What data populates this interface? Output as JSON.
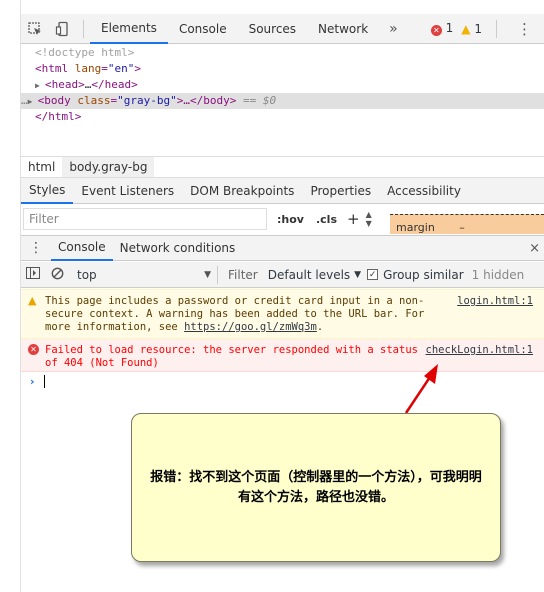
{
  "toolbar": {
    "tabs": [
      "Elements",
      "Console",
      "Sources",
      "Network"
    ],
    "active_tab": "Elements",
    "more": "»",
    "error_count": "1",
    "warning_count": "1",
    "icons": [
      "inspect-icon",
      "device-toolbar-icon",
      "kebab-menu-icon"
    ]
  },
  "dom": {
    "line1": "<!doctype html>",
    "line2_tag": "<html",
    "line2_attr": "lang",
    "line2_val": "\"en\"",
    "line2_end": ">",
    "line3_open": "<head>",
    "line3_mid": "…",
    "line3_close": "</head>",
    "line4_prefix": "…",
    "line4_open": "<body",
    "line4_attr": "class",
    "line4_val": "\"gray-bg\"",
    "line4_mid": ">…",
    "line4_close": "</body>",
    "line4_suffix": "== $0",
    "line5": "</html>"
  },
  "breadcrumbs": [
    "html",
    "body.gray-bg"
  ],
  "subtabs": [
    "Styles",
    "Event Listeners",
    "DOM Breakpoints",
    "Properties",
    "Accessibility"
  ],
  "styles": {
    "filter_placeholder": "Filter",
    "hov": ":hov",
    "cls": ".cls",
    "plus": "+",
    "box_label": "margin",
    "box_value": "–"
  },
  "drawer": {
    "tabs": [
      "Console",
      "Network conditions"
    ],
    "close": "×"
  },
  "console_bar": {
    "context": "top",
    "filter": "Filter",
    "levels": "Default levels",
    "group_similar": "Group similar",
    "hidden": "1 hidden"
  },
  "messages": {
    "warning_text_1": "This page includes a password or credit card input in a non-secure context. A warning has been added to the URL bar. For more information, see ",
    "warning_link": "https://goo.gl/zmWq3m",
    "warning_text_2": ".",
    "warning_source": "login.html:1",
    "error_text": "Failed to load resource: the server responded with a status of 404 (Not Found)",
    "error_source": "checkLogin.html:1"
  },
  "annotation": {
    "text": "报错：找不到这个页面（控制器里的一个方法），可我明明有这个方法，路径也没错。"
  }
}
